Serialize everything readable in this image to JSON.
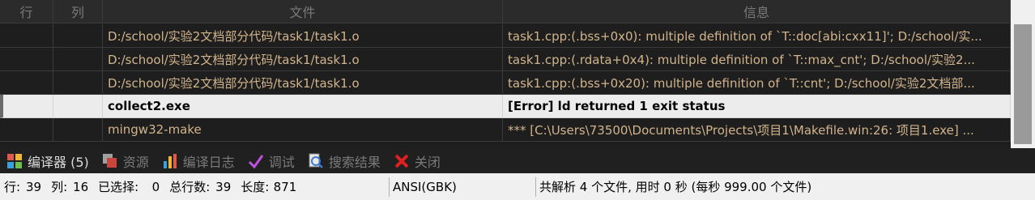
{
  "table": {
    "headers": {
      "row": "行",
      "col": "列",
      "file": "文件",
      "info": "信息"
    },
    "rows": [
      {
        "row": "",
        "col": "",
        "file": "D:/school/实验2文档部分代码/task1/task1.o",
        "info": "task1.cpp:(.bss+0x0): multiple definition of `T::doc[abi:cxx11]'; D:/school/实..."
      },
      {
        "row": "",
        "col": "",
        "file": "D:/school/实验2文档部分代码/task1/task1.o",
        "info": "task1.cpp:(.rdata+0x4): multiple definition of `T::max_cnt'; D:/school/实验2..."
      },
      {
        "row": "",
        "col": "",
        "file": "D:/school/实验2文档部分代码/task1/task1.o",
        "info": "task1.cpp:(.bss+0x20): multiple definition of `T::cnt'; D:/school/实验2文档部..."
      },
      {
        "row": "",
        "col": "",
        "file": "collect2.exe",
        "info": "[Error] ld returned 1 exit status"
      },
      {
        "row": "",
        "col": "",
        "file": "mingw32-make",
        "info": "*** [C:\\Users\\73500\\Documents\\Projects\\项目1\\Makefile.win:26: 项目1.exe] ..."
      }
    ],
    "selected_index": 3
  },
  "tabs": [
    {
      "label": "编译器 (5)",
      "icon": "compiler-grid-icon",
      "active": true
    },
    {
      "label": "资源",
      "icon": "resources-icon",
      "active": false
    },
    {
      "label": "编译日志",
      "icon": "bar-chart-icon",
      "active": false
    },
    {
      "label": "调试",
      "icon": "checkmark-icon",
      "active": false
    },
    {
      "label": "搜索结果",
      "icon": "search-icon",
      "active": false
    },
    {
      "label": "关闭",
      "icon": "close-x-icon",
      "active": false
    }
  ],
  "status": {
    "line_label": "行:",
    "line_value": "39",
    "col_label": "列:",
    "col_value": "16",
    "sel_label": "已选择:",
    "sel_value": "0",
    "total_label": "总行数:",
    "total_value": "39",
    "len_label": "长度:",
    "len_value": "871",
    "encoding": "ANSI(GBK)",
    "message": "共解析 4 个文件, 用时 0 秒 (每秒 999.00 个文件)"
  }
}
